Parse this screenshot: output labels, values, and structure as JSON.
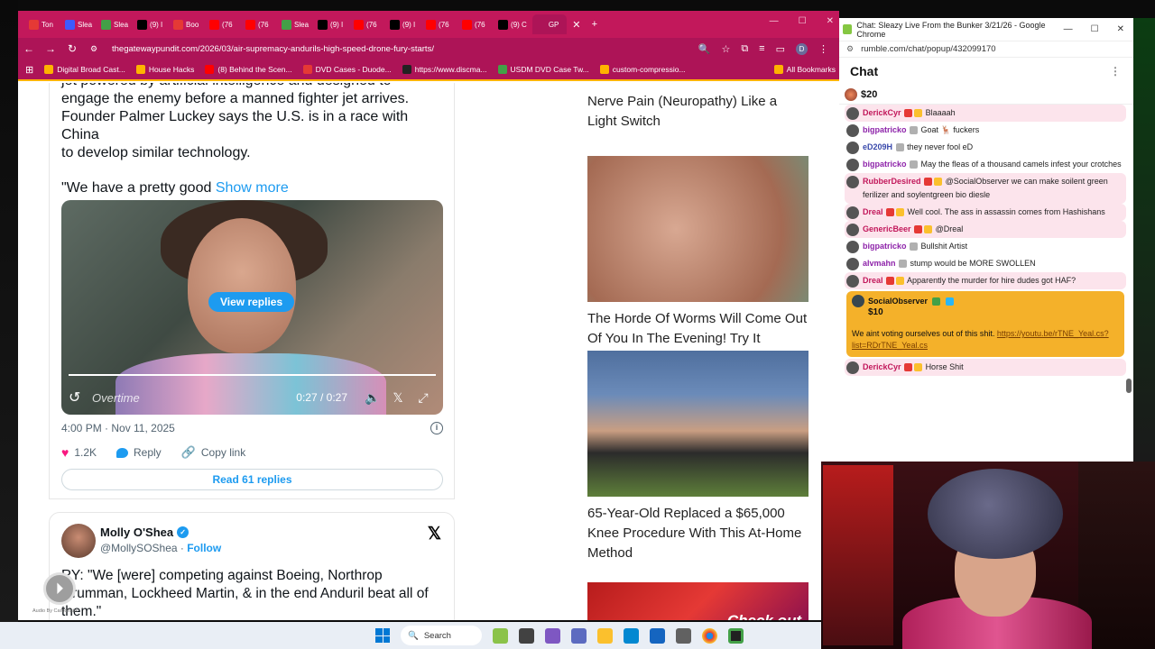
{
  "browser": {
    "tabs": [
      {
        "label": "Ton",
        "color": "#e53935"
      },
      {
        "label": "Slea",
        "color": "#3d5afe"
      },
      {
        "label": "Slea",
        "color": "#43a047"
      },
      {
        "label": "(9) I",
        "color": "#000000"
      },
      {
        "label": "Boo",
        "color": "#e53935"
      },
      {
        "label": "(76",
        "color": "#ff0000"
      },
      {
        "label": "(76",
        "color": "#ff0000"
      },
      {
        "label": "Slea",
        "color": "#43a047"
      },
      {
        "label": "(9) I",
        "color": "#000000"
      },
      {
        "label": "(76",
        "color": "#ff0000"
      },
      {
        "label": "(9) I",
        "color": "#000000"
      },
      {
        "label": "(76",
        "color": "#ff0000"
      },
      {
        "label": "(76",
        "color": "#ff0000"
      },
      {
        "label": "(9) C",
        "color": "#000000"
      },
      {
        "label": "GP",
        "color": "#ad1457"
      }
    ],
    "url": "thegatewaypundit.com/2026/03/air-supremacy-andurils-high-speed-drone-fury-starts/",
    "profile_initial": "D",
    "bookmarks": [
      {
        "label": "Digital Broad Cast...",
        "color": "#ffb300"
      },
      {
        "label": "House Hacks",
        "color": "#ffb300"
      },
      {
        "label": "(8) Behind the Scen...",
        "color": "#ff0000"
      },
      {
        "label": "DVD Cases - Duode...",
        "color": "#e53935"
      },
      {
        "label": "https://www.discma...",
        "color": "#222222"
      },
      {
        "label": "USDM DVD Case Tw...",
        "color": "#43a047"
      },
      {
        "label": "custom-compressio...",
        "color": "#ffb300"
      },
      {
        "label": "All Bookmarks",
        "color": "#ffb300"
      }
    ]
  },
  "tweet": {
    "text_line0": "jet powered by artificial intelligence and designed to",
    "text_lines": [
      "engage the enemy before a manned fighter jet arrives.",
      "Founder Palmer Luckey says the U.S. is in a race with China",
      "to develop similar technology."
    ],
    "quote_text": "\"We have a pretty good ",
    "show_more": "Show more",
    "view_replies": "View replies",
    "video_brand": "Overtime",
    "video_time": "0:27 / 0:27",
    "video_progress": 1.0,
    "timestamp": "4:00 PM · Nov 11, 2025",
    "likes": "1.2K",
    "reply_label": "Reply",
    "copy_link_label": "Copy link",
    "read_replies": "Read 61 replies"
  },
  "tweet2": {
    "name": "Molly O'Shea",
    "handle": "@MollySOShea",
    "separator": " · ",
    "follow": "Follow",
    "text": "RY: \"We [were] competing against Boeing, Northrop Grumman, Lockheed Martin, & in the end Anduril beat all of them.\""
  },
  "floating_caption": "Audio By Carbonatix",
  "ads": [
    {
      "title": "Nerve Pain (Neuropathy) Like a Light Switch"
    },
    {
      "title": "The Horde Of Worms Will Come Out Of You In The Evening! Try It"
    },
    {
      "title": "65-Year-Old Replaced a $65,000 Knee Procedure With This At-Home Method"
    },
    {
      "title": "Check out"
    }
  ],
  "chat": {
    "window_title": "Chat: Sleazy Live From the Bunker 3/21/26 - Google Chrome",
    "url": "rumble.com/chat/popup/432099170",
    "header": "Chat",
    "pinned_rant": "$20",
    "messages": [
      {
        "user": "DerickCyr",
        "color": "#c2185b",
        "text": "Blaaaah",
        "hl": true
      },
      {
        "user": "bigpatricko",
        "color": "#8e24aa",
        "text": "Goat 🦌 fuckers",
        "hl": false
      },
      {
        "user": "eD209H",
        "color": "#3949ab",
        "text": "they never fool eD",
        "hl": false
      },
      {
        "user": "bigpatricko",
        "color": "#8e24aa",
        "text": "May the fleas of a thousand camels infest your crotches",
        "hl": false
      },
      {
        "user": "RubberDesired",
        "color": "#c2185b",
        "text": "@SocialObserver we can make soilent green ferilizer and soylentgreen bio diesle",
        "hl": true
      },
      {
        "user": "Dreal",
        "color": "#c2185b",
        "text": "Well cool. The ass in assassin comes from Hashishans",
        "hl": true
      },
      {
        "user": "GenericBeer",
        "color": "#c2185b",
        "text": "@Dreal",
        "hl": true
      },
      {
        "user": "bigpatricko",
        "color": "#8e24aa",
        "text": "Bullshit Artist",
        "hl": false
      },
      {
        "user": "alvmahn",
        "color": "#8e24aa",
        "text": "stump would be MORE SWOLLEN",
        "hl": false
      },
      {
        "user": "Dreal",
        "color": "#c2185b",
        "text": "Apparently the murder for hire dudes got HAF?",
        "hl": true
      }
    ],
    "rant": {
      "user": "SocialObserver",
      "amount": "$10",
      "text": "We aint voting ourselves out of this shit. ",
      "link": "https://youtu.be/rTNE_Yeal.cs?list=RDrTNE_Yeal.cs"
    },
    "last_message": {
      "user": "DerickCyr",
      "text": "Horse Shit"
    }
  },
  "taskbar": {
    "search_label": "Search"
  }
}
